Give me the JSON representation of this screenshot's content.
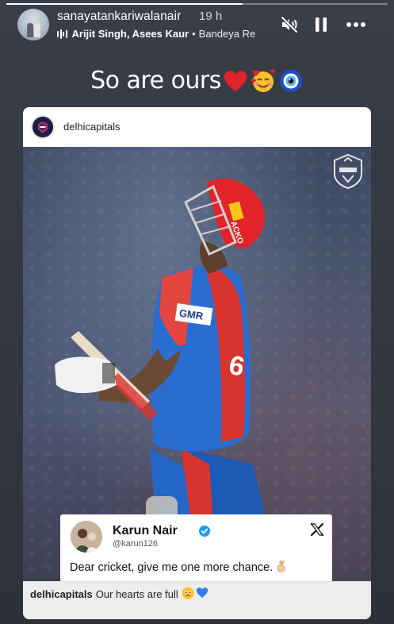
{
  "header": {
    "username": "sanayatankariwalanair",
    "time": "19 h",
    "music": {
      "artist": "Arijit Singh, Asees Kaur",
      "separator": "•",
      "song": "Bandeya Re"
    },
    "controls": {
      "mute_icon": "speaker-muted-icon",
      "pause_icon": "pause-icon",
      "more_icon": "more-options-icon"
    }
  },
  "caption": {
    "text": "So are ours",
    "emojis": [
      "red-heart",
      "smiling-face-with-hearts",
      "nazar-amulet"
    ]
  },
  "post": {
    "account": "delhicapitals",
    "tweet": {
      "name": "Karun Nair",
      "handle": "@karun126",
      "text": "Dear cricket, give me one more chance.",
      "emoji": "crossed-fingers",
      "platform_icon": "x-logo-icon"
    },
    "footer": {
      "user": "delhicapitals",
      "text": "Our hearts are full",
      "emojis": [
        "face-holding-back-tears",
        "blue-heart"
      ]
    }
  },
  "colors": {
    "background": "#2e3238",
    "dc_blue": "#17214a",
    "dc_red": "#e2232a",
    "verified": "#1d9bf0"
  }
}
